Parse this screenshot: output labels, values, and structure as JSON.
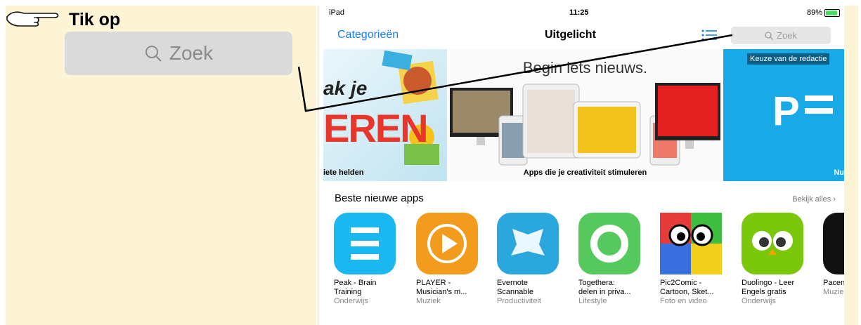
{
  "instruction": {
    "label": "Tik op",
    "search_placeholder": "Zoek"
  },
  "status_bar": {
    "device": "iPad",
    "time": "11:25",
    "battery": "89%",
    "battery_level": 0.89
  },
  "nav": {
    "categories": "Categorieën",
    "title": "Uitgelicht",
    "search_placeholder": "Zoek"
  },
  "banners": [
    {
      "big": "ak je",
      "ren": "EREN",
      "caption": "iete helden"
    },
    {
      "headline": "Begin iets nieuws.",
      "caption": "Apps die je creativiteit stimuleren"
    },
    {
      "tag": "Keuze van de redactie",
      "letter": "P",
      "caption": "Nu"
    }
  ],
  "section": {
    "title": "Beste nieuwe apps",
    "more": "Bekijk alles"
  },
  "apps": [
    {
      "name1": "Peak - Brain",
      "name2": "Training",
      "category": "Onderwijs",
      "icon": "peak-icon",
      "color": "#1bb7f0"
    },
    {
      "name1": "PLAYER -",
      "name2": "Musician's m...",
      "category": "Muziek",
      "icon": "player-icon",
      "color": "#f29b1c"
    },
    {
      "name1": "Evernote",
      "name2": "Scannable",
      "category": "Productiviteit",
      "icon": "evernote-icon",
      "color": "#2aa8dd"
    },
    {
      "name1": "Togethera:",
      "name2": "delen in priva...",
      "category": "Lifestyle",
      "icon": "togethera-icon",
      "color": "#55c85e"
    },
    {
      "name1": "Pic2Comic -",
      "name2": "Cartoon, Sket...",
      "category": "Foto en video",
      "icon": "pic2comic-icon",
      "color": "#333333"
    },
    {
      "name1": "Duolingo - Leer",
      "name2": "Engels gratis",
      "category": "Onderwijs",
      "icon": "duolingo-icon",
      "color": "#7ac70c"
    },
    {
      "name1": "Pacen",
      "name2": "",
      "category": "Muzie",
      "icon": "pacer-icon",
      "color": "#111111"
    }
  ]
}
